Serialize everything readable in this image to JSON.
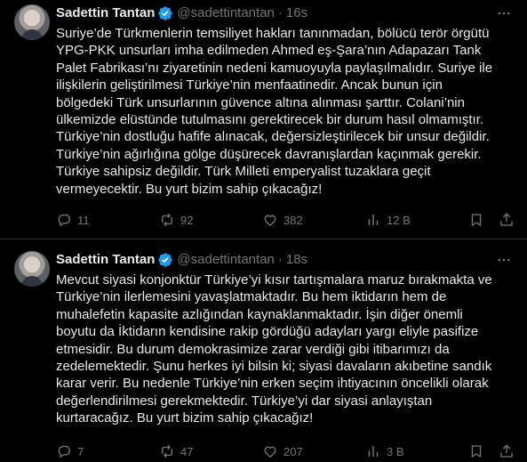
{
  "tweets": [
    {
      "author_name": "Sadettin Tantan",
      "handle": "@sadettintantan",
      "separator": "·",
      "time": "16s",
      "text": "Suriye’de Türkmenlerin temsiliyet hakları tanınmadan, bölücü terör örgütü\nYPG-PKK unsurları imha edilmeden Ahmed eş-Şara’nın Adapazarı Tank\nPalet Fabrikası’nı ziyaretinin nedeni kamuoyuyla paylaşılmalıdır. Suriye ile\nilişkilerin geliştirilmesi Türkiye’nin menfaatinedir. Ancak bunun için\nbölgedeki Türk unsurlarının güvence altına alınması şarttır. Colani’nin\nülkemizde elüstünde tutulmasını gerektirecek bir durum hasıl olmamıştır.\nTürkiye’nin dostluğu hafife alınacak, değersizleştirilecek bir unsur değildir.\nTürkiye’nin ağırlığına gölge düşürecek davranışlardan kaçınmak gerekir.\nTürkiye sahipsiz değildir. Türk Milleti emperyalist tuzaklara geçit\nvermeyecektir. Bu yurt bizim sahip çıkacağız!",
      "replies": "11",
      "reposts": "92",
      "likes": "382",
      "views": "12 B"
    },
    {
      "author_name": "Sadettin Tantan",
      "handle": "@sadettintantan",
      "separator": "·",
      "time": "18s",
      "text": "Mevcut siyasi konjonktür Türkiye’yi kısır tartışmalara maruz bırakmakta ve\nTürkiye’nin ilerlemesini yavaşlatmaktadır. Bu hem iktidarın hem de\nmuhalefetin kapasite azlığından kaynaklanmaktadır. İşin diğer önemli\nboyutu da İktidarın kendisine rakip gördüğü adayları yargı eliyle pasifize\netmesidir. Bu durum demokrasimize zarar verdiği gibi itibarımızı da\nzedelemektedir. Şunu herkes iyi bilsin ki; siyasi davaların akıbetine sandık\nkarar verir. Bu nedenle Türkiye’nin erken seçim ihtiyacının öncelikli olarak\ndeğerlendirilmesi gerekmektedir. Türkiye’yi dar siyasi anlayıştan\nkurtaracağız. Bu yurt bizim sahip çıkacağız!",
      "replies": "7",
      "reposts": "47",
      "likes": "207",
      "views": "3 B"
    }
  ],
  "colors": {
    "background": "#000000",
    "text": "#e7e9ea",
    "muted": "#71767b",
    "verified": "#1d9bf0",
    "divider": "#2f3336"
  },
  "icons": [
    "verified-badge-icon",
    "more-icon",
    "reply-icon",
    "repost-icon",
    "like-icon",
    "views-icon",
    "bookmark-icon",
    "share-icon"
  ]
}
